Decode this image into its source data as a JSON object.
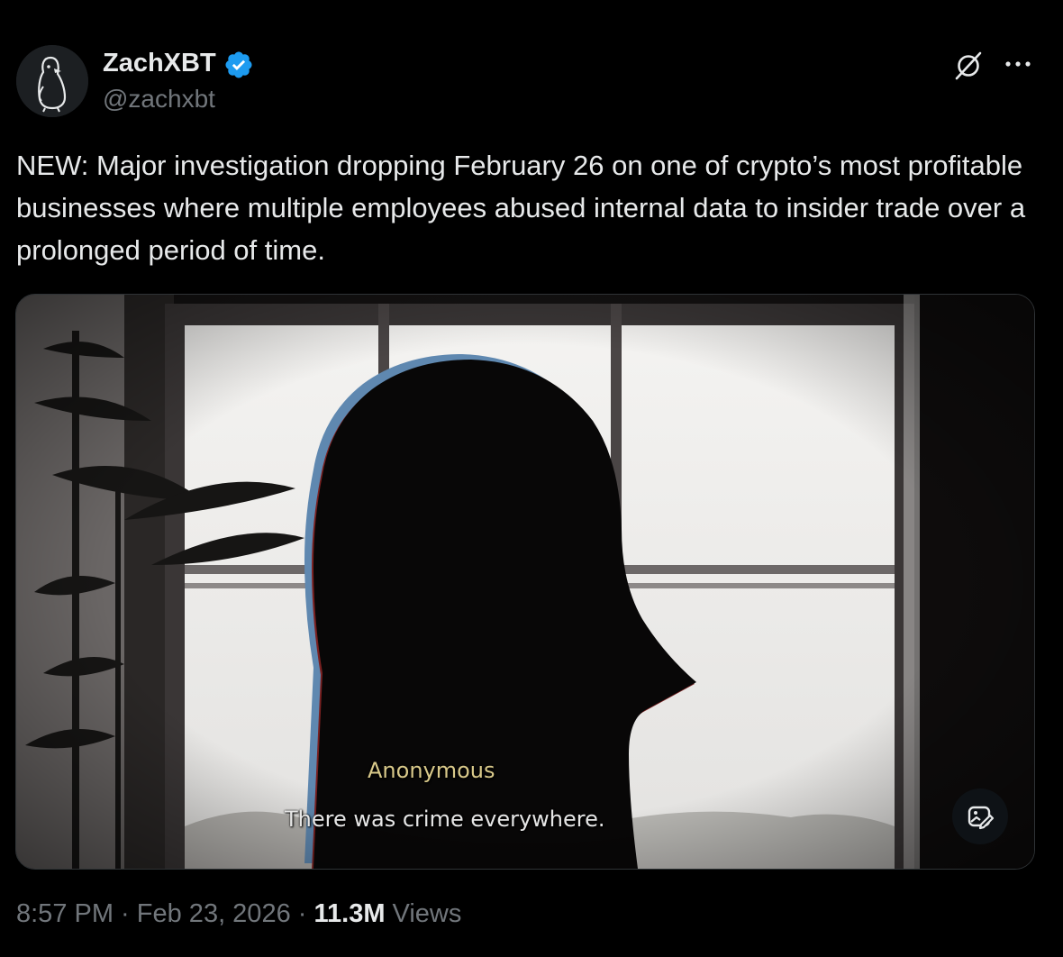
{
  "author": {
    "display_name": "ZachXBT",
    "handle": "@zachxbt",
    "verified": true,
    "avatar_icon": "penguin-avatar-icon",
    "verified_color": "#1d9bf0"
  },
  "header_actions": {
    "grok_icon": "grok-icon",
    "more_icon": "more-horizontal-icon"
  },
  "tweet": {
    "text": "NEW: Major investigation dropping February 26 on one of crypto’s most profitable businesses where multiple employees abused internal data to insider trade over a prolonged period of time."
  },
  "media": {
    "subtitle_speaker": "Anonymous",
    "subtitle_line": "There was crime everywhere.",
    "alt_button_icon": "image-alt-icon"
  },
  "meta": {
    "time": "8:57 PM",
    "separator": " · ",
    "date": "Feb 23, 2026",
    "views_count": "11.3M",
    "views_label": " Views"
  },
  "colors": {
    "background": "#000000",
    "text_primary": "#e7e9ea",
    "text_secondary": "#71767b",
    "accent": "#1d9bf0"
  }
}
